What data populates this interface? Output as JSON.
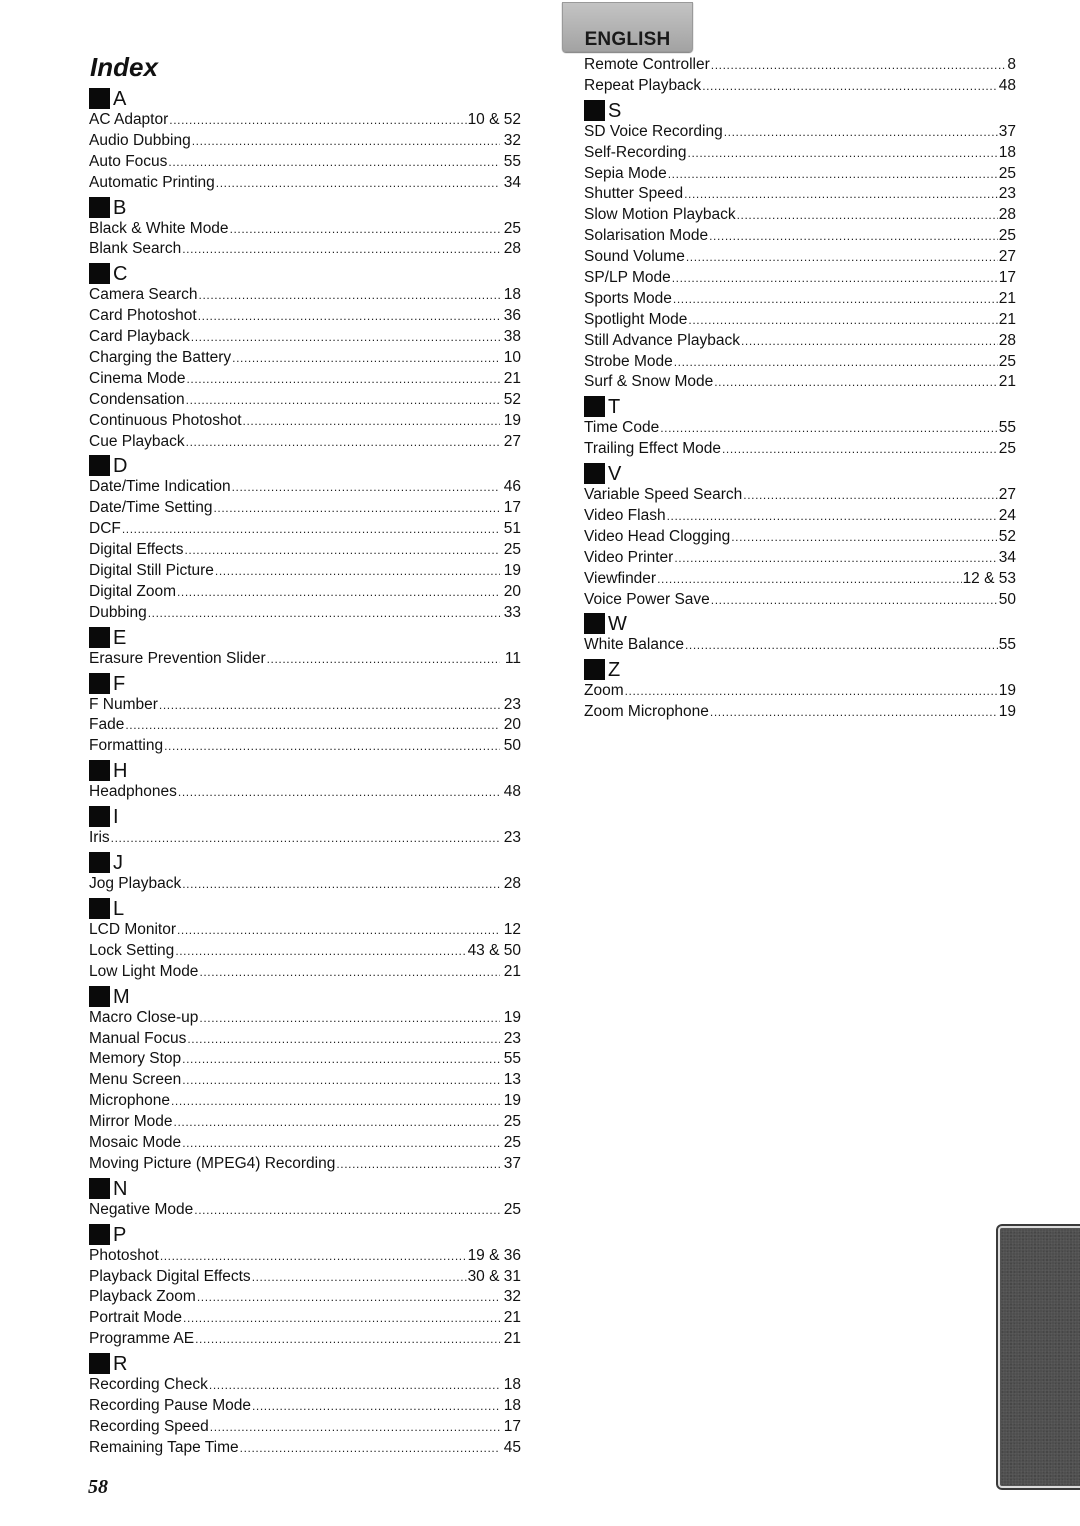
{
  "header": {
    "language_tab": "ENGLISH",
    "title": "Index"
  },
  "left_column": [
    {
      "letter": "A",
      "entries": [
        {
          "term": "AC Adaptor",
          "page": "10 & 52"
        },
        {
          "term": "Audio Dubbing",
          "page": "32"
        },
        {
          "term": "Auto Focus",
          "page": "55"
        },
        {
          "term": "Automatic Printing",
          "page": "34"
        }
      ]
    },
    {
      "letter": "B",
      "entries": [
        {
          "term": "Black & White Mode",
          "page": "25"
        },
        {
          "term": "Blank Search",
          "page": "28"
        }
      ]
    },
    {
      "letter": "C",
      "entries": [
        {
          "term": "Camera Search",
          "page": "18"
        },
        {
          "term": "Card Photoshot",
          "page": "36"
        },
        {
          "term": "Card Playback",
          "page": "38"
        },
        {
          "term": "Charging the Battery",
          "page": "10"
        },
        {
          "term": "Cinema Mode",
          "page": "21"
        },
        {
          "term": "Condensation",
          "page": "52"
        },
        {
          "term": "Continuous Photoshot",
          "page": "19"
        },
        {
          "term": "Cue Playback",
          "page": "27"
        }
      ]
    },
    {
      "letter": "D",
      "entries": [
        {
          "term": "Date/Time Indication",
          "page": "46"
        },
        {
          "term": "Date/Time Setting",
          "page": "17"
        },
        {
          "term": "DCF",
          "page": "51"
        },
        {
          "term": "Digital Effects",
          "page": "25"
        },
        {
          "term": "Digital Still Picture",
          "page": "19"
        },
        {
          "term": "Digital Zoom",
          "page": "20"
        },
        {
          "term": "Dubbing",
          "page": "33"
        }
      ]
    },
    {
      "letter": "E",
      "entries": [
        {
          "term": "Erasure Prevention Slider",
          "page": "11"
        }
      ]
    },
    {
      "letter": "F",
      "entries": [
        {
          "term": "F Number",
          "page": "23"
        },
        {
          "term": "Fade",
          "page": "20"
        },
        {
          "term": "Formatting",
          "page": "50"
        }
      ]
    },
    {
      "letter": "H",
      "entries": [
        {
          "term": "Headphones",
          "page": "48"
        }
      ]
    },
    {
      "letter": "I",
      "entries": [
        {
          "term": "Iris",
          "page": "23"
        }
      ]
    },
    {
      "letter": "J",
      "entries": [
        {
          "term": "Jog Playback",
          "page": "28"
        }
      ]
    },
    {
      "letter": "L",
      "entries": [
        {
          "term": "LCD Monitor",
          "page": "12"
        },
        {
          "term": "Lock Setting",
          "page": "43 & 50"
        },
        {
          "term": "Low Light Mode",
          "page": "21"
        }
      ]
    },
    {
      "letter": "M",
      "entries": [
        {
          "term": "Macro Close-up",
          "page": "19"
        },
        {
          "term": "Manual Focus",
          "page": "23"
        },
        {
          "term": "Memory Stop",
          "page": "55"
        },
        {
          "term": "Menu Screen",
          "page": "13"
        },
        {
          "term": "Microphone",
          "page": "19"
        },
        {
          "term": "Mirror Mode",
          "page": "25"
        },
        {
          "term": "Mosaic Mode",
          "page": "25"
        },
        {
          "term": "Moving Picture (MPEG4) Recording",
          "page": "37"
        }
      ]
    },
    {
      "letter": "N",
      "entries": [
        {
          "term": "Negative Mode",
          "page": "25"
        }
      ]
    },
    {
      "letter": "P",
      "entries": [
        {
          "term": "Photoshot",
          "page": "19 & 36"
        },
        {
          "term": "Playback Digital Effects",
          "page": "30 & 31"
        },
        {
          "term": "Playback Zoom",
          "page": "32"
        },
        {
          "term": "Portrait Mode",
          "page": "21"
        },
        {
          "term": "Programme AE",
          "page": "21"
        }
      ]
    },
    {
      "letter": "R",
      "entries": [
        {
          "term": "Recording Check",
          "page": "18"
        },
        {
          "term": "Recording Pause Mode",
          "page": "18"
        },
        {
          "term": "Recording Speed",
          "page": "17"
        },
        {
          "term": "Remaining Tape Time",
          "page": "45"
        }
      ]
    }
  ],
  "right_column": [
    {
      "letter": "",
      "entries": [
        {
          "term": "Remote Controller",
          "page": "8"
        },
        {
          "term": "Repeat Playback",
          "page": "48"
        }
      ]
    },
    {
      "letter": "S",
      "entries": [
        {
          "term": "SD Voice Recording",
          "page": "37"
        },
        {
          "term": "Self-Recording",
          "page": "18"
        },
        {
          "term": "Sepia Mode",
          "page": "25"
        },
        {
          "term": "Shutter Speed",
          "page": "23"
        },
        {
          "term": "Slow Motion Playback",
          "page": "28"
        },
        {
          "term": "Solarisation Mode",
          "page": "25"
        },
        {
          "term": "Sound Volume",
          "page": "27"
        },
        {
          "term": "SP/LP Mode",
          "page": "17"
        },
        {
          "term": "Sports Mode",
          "page": "21"
        },
        {
          "term": "Spotlight Mode",
          "page": "21"
        },
        {
          "term": "Still Advance Playback",
          "page": "28"
        },
        {
          "term": "Strobe Mode",
          "page": "25"
        },
        {
          "term": "Surf & Snow Mode",
          "page": "21"
        }
      ]
    },
    {
      "letter": "T",
      "entries": [
        {
          "term": "Time Code",
          "page": "55"
        },
        {
          "term": "Trailing Effect Mode",
          "page": "25"
        }
      ]
    },
    {
      "letter": "V",
      "entries": [
        {
          "term": "Variable Speed Search",
          "page": "27"
        },
        {
          "term": "Video Flash",
          "page": "24"
        },
        {
          "term": "Video Head Clogging",
          "page": "52"
        },
        {
          "term": "Video Printer",
          "page": "34"
        },
        {
          "term": "Viewfinder",
          "page": "12 & 53"
        },
        {
          "term": "Voice Power Save",
          "page": "50"
        }
      ]
    },
    {
      "letter": "W",
      "entries": [
        {
          "term": "White Balance",
          "page": "55"
        }
      ]
    },
    {
      "letter": "Z",
      "entries": [
        {
          "term": "Zoom",
          "page": "19"
        },
        {
          "term": "Zoom Microphone",
          "page": "19"
        }
      ]
    }
  ],
  "footer": {
    "page_number": "58"
  }
}
